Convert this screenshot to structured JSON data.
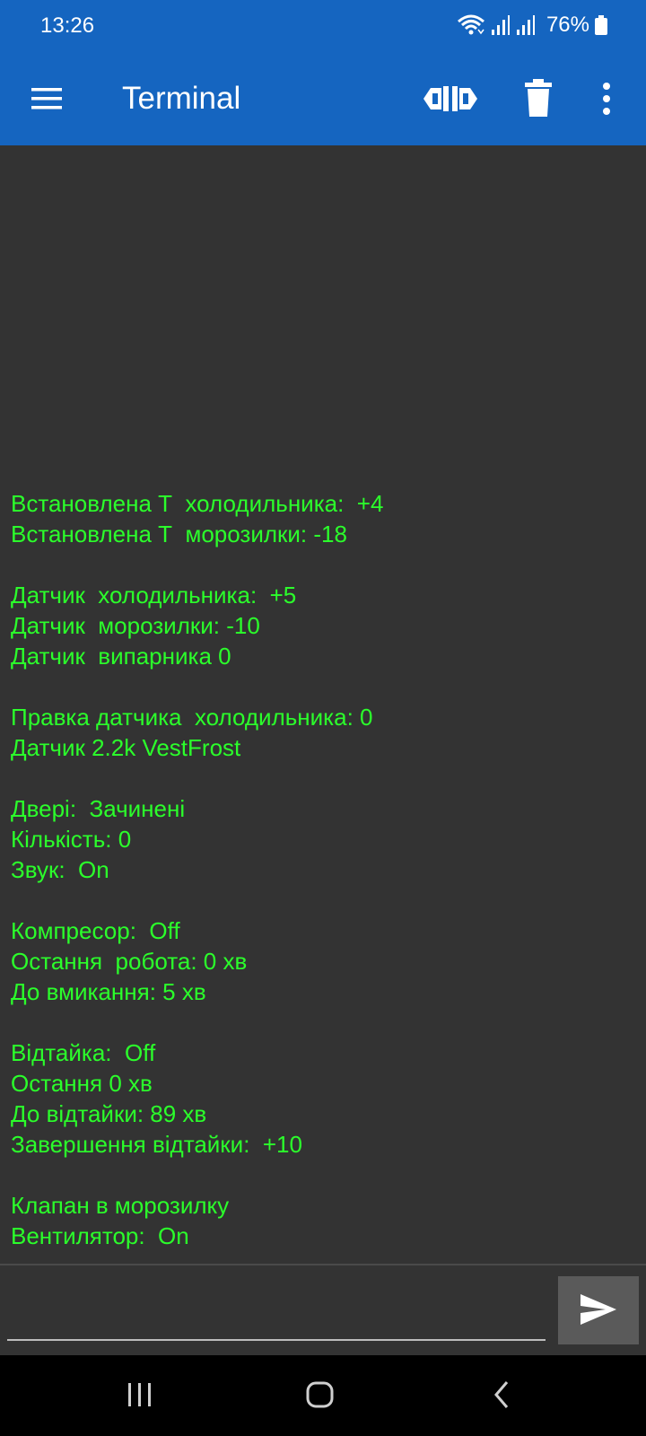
{
  "status_bar": {
    "time": "13:26",
    "battery_percent": "76%",
    "icons": [
      "wifi-icon",
      "signal-icon",
      "signal-icon",
      "battery-icon"
    ]
  },
  "app_bar": {
    "title": "Terminal",
    "icons": [
      "menu-icon",
      "connect-icon",
      "trash-icon",
      "more-vert-icon"
    ]
  },
  "terminal": {
    "text_color": "#2bff2b",
    "background": "#333333",
    "lines": [
      "Встановлена Т  холодильника:  +4",
      "Встановлена Т  морозилки: -18",
      "",
      "Датчик  холодильника:  +5",
      "Датчик  морозилки: -10",
      "Датчик  випарника 0",
      "",
      "Правка датчика  холодильника: 0",
      "Датчик 2.2k VestFrost",
      "",
      "Двері:  Зачинені",
      "Кількість: 0",
      "Звук:  On",
      "",
      "Компресор:  Off",
      "Остання  робота: 0 хв",
      "До вмикання: 5 хв",
      "",
      "Відтайка:  Off",
      "Остання 0 хв",
      "До відтайки: 89 хв",
      "Завершення відтайки:  +10",
      "",
      "Клапан в морозилку",
      "Вентилятор:  On"
    ]
  },
  "input": {
    "value": "",
    "placeholder": "",
    "send_icon": "send-icon"
  },
  "nav_bar": {
    "icons": [
      "recent-apps-icon",
      "home-icon",
      "back-icon"
    ]
  },
  "colors": {
    "primary": "#1565c0",
    "terminal_bg": "#333333",
    "terminal_text": "#2bff2b",
    "send_button_bg": "#5a5a5a"
  }
}
